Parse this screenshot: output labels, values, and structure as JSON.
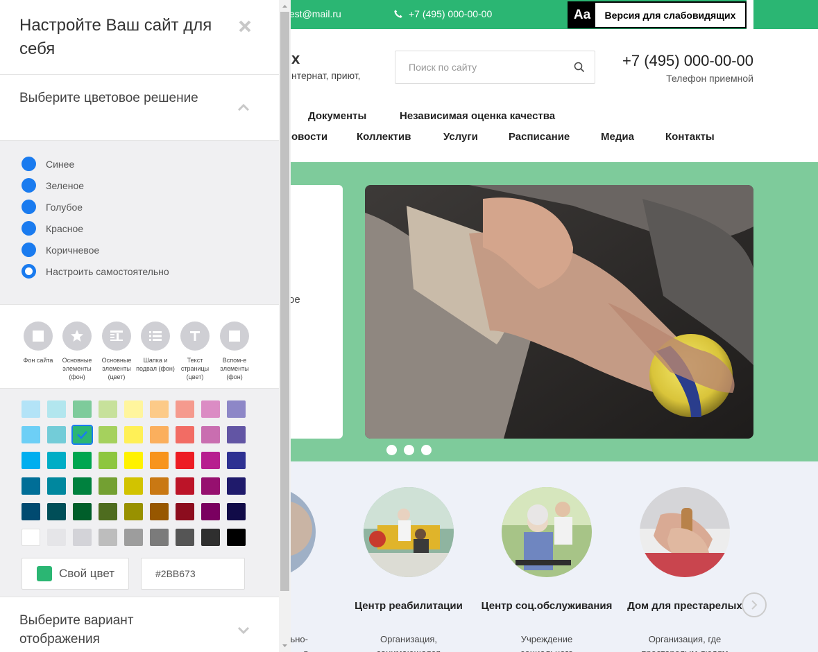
{
  "topbar": {
    "email": "test@mail.ru",
    "phone": "+7 (495) 000-00-00",
    "a11y_icon": "Aa",
    "a11y_label": "Версия для слабовидящих",
    "accent": "#2bb673"
  },
  "header": {
    "name_fragment": "х",
    "tagline_fragment": "нтернат, приют,",
    "search_placeholder": "Поиск по сайту",
    "phone": "+7 (495) 000-00-00",
    "phone_caption": "Телефон приемной"
  },
  "nav": {
    "row1": [
      "Документы",
      "Независимая оценка качества"
    ],
    "row2": [
      "овости",
      "Коллектив",
      "Услуги",
      "Расписание",
      "Медиа",
      "Контакты"
    ]
  },
  "hero": {
    "card_text_fragment": "ое",
    "background": "#7ecb9b",
    "slides": 3
  },
  "services": [
    {
      "title": "",
      "desc": [
        "ьно-",
        "я"
      ]
    },
    {
      "title": "Центр реабилитации",
      "desc": [
        "Организация,",
        "занимающаяся"
      ]
    },
    {
      "title": "Центр соц.обслуживания",
      "desc": [
        "Учреждение",
        "социального"
      ]
    },
    {
      "title": "Дом для престарелых",
      "desc": [
        "Организация, где",
        "престарелым людям"
      ]
    }
  ],
  "panel": {
    "title": "Настройте Ваш сайт для себя",
    "color_section_title": "Выберите цветовое решение",
    "schemes": [
      {
        "label": "Синее",
        "selected": false
      },
      {
        "label": "Зеленое",
        "selected": false
      },
      {
        "label": "Голубое",
        "selected": false
      },
      {
        "label": "Красное",
        "selected": false
      },
      {
        "label": "Коричневое",
        "selected": false
      },
      {
        "label": "Настроить самостоятельно",
        "selected": true
      }
    ],
    "elements": [
      {
        "label": "Фон сайта",
        "icon": "square-icon"
      },
      {
        "label": "Основные элементы (фон)",
        "icon": "star-icon"
      },
      {
        "label": "Основные элементы (цвет)",
        "icon": "text-block-icon"
      },
      {
        "label": "Шапка и подвал (фон)",
        "icon": "list-icon",
        "active": true
      },
      {
        "label": "Текст страницы (цвет)",
        "icon": "letter-t-icon"
      },
      {
        "label": "Вспом-е элементы (фон)",
        "icon": "square-icon"
      }
    ],
    "palette": [
      [
        "#b3e3f7",
        "#b2e6ee",
        "#7ecb9b",
        "#c7e19b",
        "#fff59d",
        "#fcca88",
        "#f59a8e",
        "#db8cc4",
        "#8d87c7"
      ],
      [
        "#6dcff6",
        "#73ccd8",
        "#2bb673",
        "#a5d15d",
        "#fff056",
        "#fbaf5d",
        "#f26c64",
        "#c96eb0",
        "#6255a4"
      ],
      [
        "#00aeef",
        "#00adc6",
        "#00a650",
        "#8dc63f",
        "#fff200",
        "#f7941d",
        "#ed1c24",
        "#b71f8f",
        "#2e3192"
      ],
      [
        "#006e97",
        "#00879e",
        "#00813e",
        "#73a032",
        "#d2c300",
        "#c97813",
        "#bc1428",
        "#96106f",
        "#1f1a6b"
      ],
      [
        "#004a70",
        "#004e58",
        "#005e2a",
        "#4e6c1f",
        "#989100",
        "#975700",
        "#8c0d1e",
        "#7a0060",
        "#110b48"
      ],
      [
        "#ffffff",
        "#e5e5e8",
        "#d3d3d8",
        "#bdbdbd",
        "#9d9d9d",
        "#7b7b7b",
        "#555555",
        "#2f2f2f",
        "#000000"
      ]
    ],
    "selected_swatch": "#2bb673",
    "own_color_label": "Свой цвет",
    "own_color_value": "#2BB673",
    "view_section_title": "Выберите вариант отображения"
  }
}
